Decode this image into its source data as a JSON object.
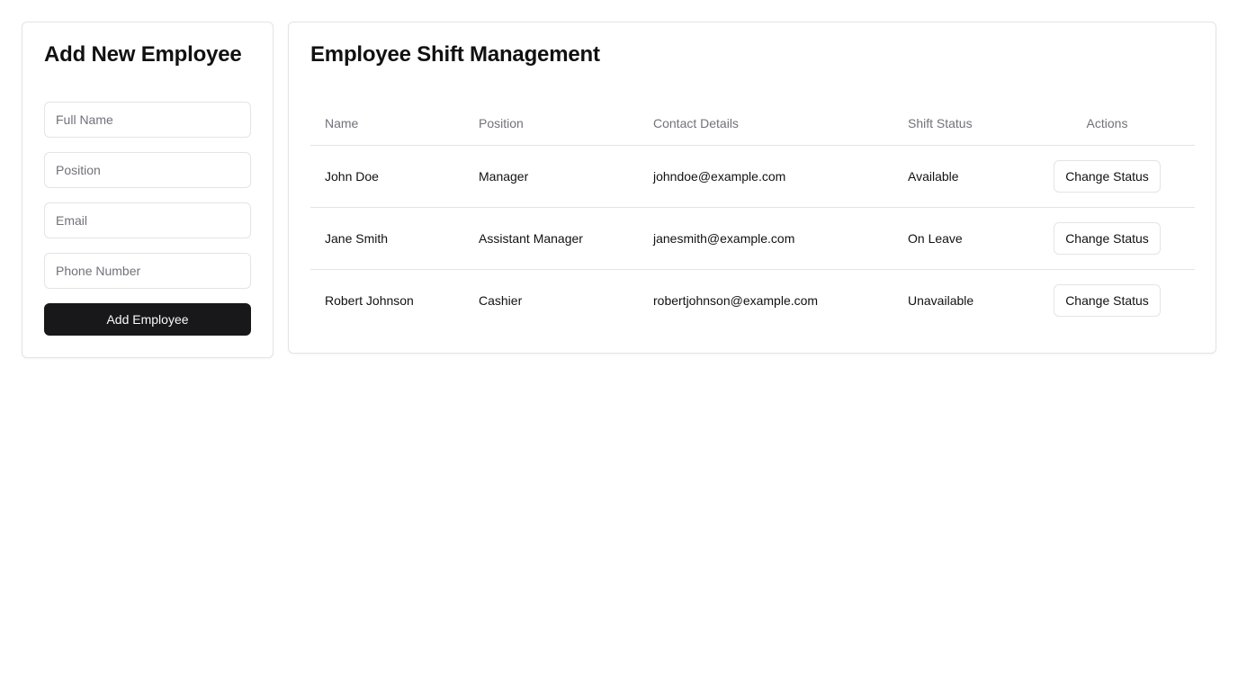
{
  "add_employee_form": {
    "title": "Add New Employee",
    "full_name_placeholder": "Full Name",
    "position_placeholder": "Position",
    "email_placeholder": "Email",
    "phone_placeholder": "Phone Number",
    "submit_label": "Add Employee"
  },
  "shift_table": {
    "title": "Employee Shift Management",
    "columns": [
      "Name",
      "Position",
      "Contact Details",
      "Shift Status",
      "Actions"
    ],
    "rows": [
      {
        "name": "John Doe",
        "position": "Manager",
        "contact": "johndoe@example.com",
        "status": "Available",
        "action_label": "Change Status"
      },
      {
        "name": "Jane Smith",
        "position": "Assistant Manager",
        "contact": "janesmith@example.com",
        "status": "On Leave",
        "action_label": "Change Status"
      },
      {
        "name": "Robert Johnson",
        "position": "Cashier",
        "contact": "robertjohnson@example.com",
        "status": "Unavailable",
        "action_label": "Change Status"
      }
    ]
  },
  "theme": {
    "primary_button_bg": "#18181b",
    "border_color": "#e4e4e7",
    "muted_text": "#71717a"
  }
}
